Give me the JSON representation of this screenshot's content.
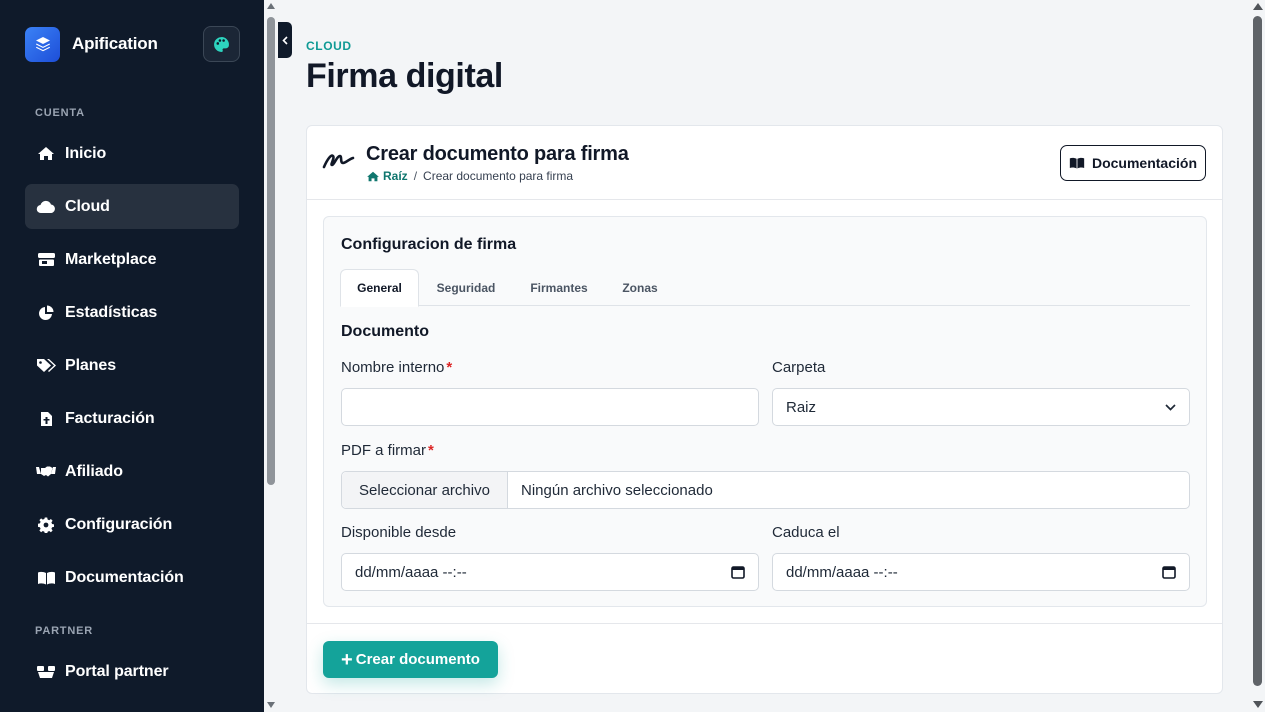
{
  "brand": {
    "name": "Apification"
  },
  "sidebar": {
    "sections": [
      {
        "label": "CUENTA"
      },
      {
        "label": "PARTNER"
      }
    ],
    "items": [
      {
        "label": "Inicio",
        "icon": "home-icon"
      },
      {
        "label": "Cloud",
        "icon": "cloud-icon",
        "active": true
      },
      {
        "label": "Marketplace",
        "icon": "store-icon"
      },
      {
        "label": "Estadísticas",
        "icon": "pie-chart-icon"
      },
      {
        "label": "Planes",
        "icon": "tags-icon"
      },
      {
        "label": "Facturación",
        "icon": "invoice-icon"
      },
      {
        "label": "Afiliado",
        "icon": "handshake-icon"
      },
      {
        "label": "Configuración",
        "icon": "gear-icon"
      },
      {
        "label": "Documentación",
        "icon": "book-icon"
      },
      {
        "label": "Portal partner",
        "icon": "partner-icon"
      }
    ]
  },
  "header": {
    "eyebrow": "CLOUD",
    "title": "Firma digital"
  },
  "card": {
    "title": "Crear documento para firma",
    "breadcrumb": {
      "root": "Raíz",
      "current": "Crear documento para firma"
    },
    "doc_button": "Documentación"
  },
  "form": {
    "title": "Configuracion de firma",
    "tabs": [
      {
        "label": "General",
        "active": true
      },
      {
        "label": "Seguridad"
      },
      {
        "label": "Firmantes"
      },
      {
        "label": "Zonas"
      }
    ],
    "section": "Documento",
    "fields": {
      "nombre": {
        "label": "Nombre interno",
        "required": "*",
        "value": ""
      },
      "carpeta": {
        "label": "Carpeta",
        "value": "Raiz"
      },
      "pdf": {
        "label": "PDF a firmar",
        "required": "*",
        "button": "Seleccionar archivo",
        "status": "Ningún archivo seleccionado"
      },
      "desde": {
        "label": "Disponible desde",
        "value": "dd/mm/aaaa --:--"
      },
      "caduca": {
        "label": "Caduca el",
        "value": "dd/mm/aaaa --:--"
      }
    },
    "submit": "Crear documento"
  },
  "colors": {
    "sidebar": "#0f1a2a",
    "accent": "#14a39a",
    "required": "#dc2626"
  }
}
